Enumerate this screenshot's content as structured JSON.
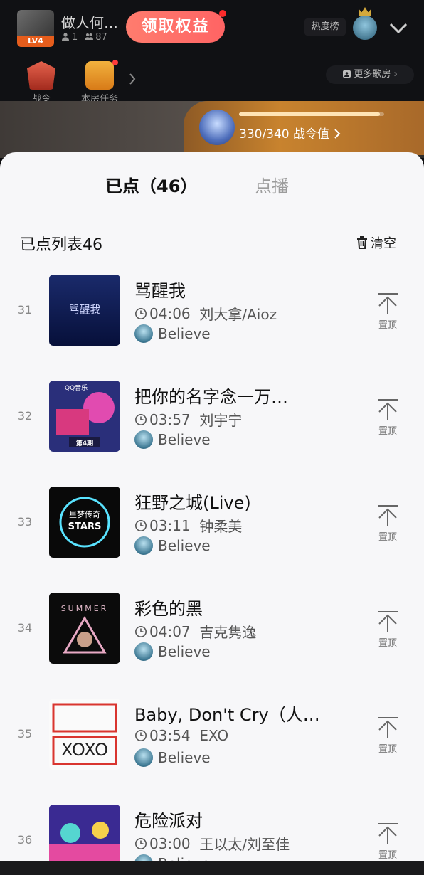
{
  "room": {
    "title": "做人何…",
    "level": "LV4",
    "online_count": "1",
    "member_count": "87",
    "claim_label": "领取权益",
    "hot_label": "热度榜"
  },
  "tools": {
    "battle_label": "战令",
    "task_label": "本房任务",
    "more_rooms_label": "更多歌房"
  },
  "battle_pass": {
    "text": "330/340 战令值",
    "progress": 0.97
  },
  "sheet": {
    "tab_ordered": "已点（46）",
    "tab_request": "点播",
    "list_title": "已点列表46",
    "clear_label": "清空"
  },
  "songs": [
    {
      "num": "31",
      "title": "骂醒我",
      "duration": "04:06",
      "artist": "刘大拿/Aioz",
      "user": "Believe",
      "pin": "置顶"
    },
    {
      "num": "32",
      "title": "把你的名字念一万…",
      "duration": "03:57",
      "artist": "刘宇宁",
      "user": "Believe",
      "pin": "置顶"
    },
    {
      "num": "33",
      "title": "狂野之城(Live)",
      "duration": "03:11",
      "artist": "钟柔美",
      "user": "Believe",
      "pin": "置顶"
    },
    {
      "num": "34",
      "title": "彩色的黑",
      "duration": "04:07",
      "artist": "吉克隽逸",
      "user": "Believe",
      "pin": "置顶"
    },
    {
      "num": "35",
      "title": "Baby, Don't Cry（人…",
      "duration": "03:54",
      "artist": "EXO",
      "user": "Believe",
      "pin": "置顶"
    },
    {
      "num": "36",
      "title": "危险派对",
      "duration": "03:00",
      "artist": "王以太/刘至佳",
      "user": "Believe",
      "pin": "置顶"
    }
  ],
  "cover_text": {
    "c1": "骂醒我",
    "c2_brand": "QQ音乐",
    "c2_episode": "第4期",
    "c3_line1": "星梦传奇",
    "c3_line2": "STARS",
    "c4": "SUMMER",
    "c5": "XOXO"
  },
  "colors": {
    "accent_red": "#ff6464",
    "pass_gold": "#c8832e",
    "sheet_bg": "#f7f7f9"
  },
  "icons": [
    "user-icon",
    "group-icon",
    "chevron-down-icon",
    "chevron-right-icon",
    "house-icon",
    "clock-icon",
    "trash-icon",
    "pin-top-icon"
  ]
}
